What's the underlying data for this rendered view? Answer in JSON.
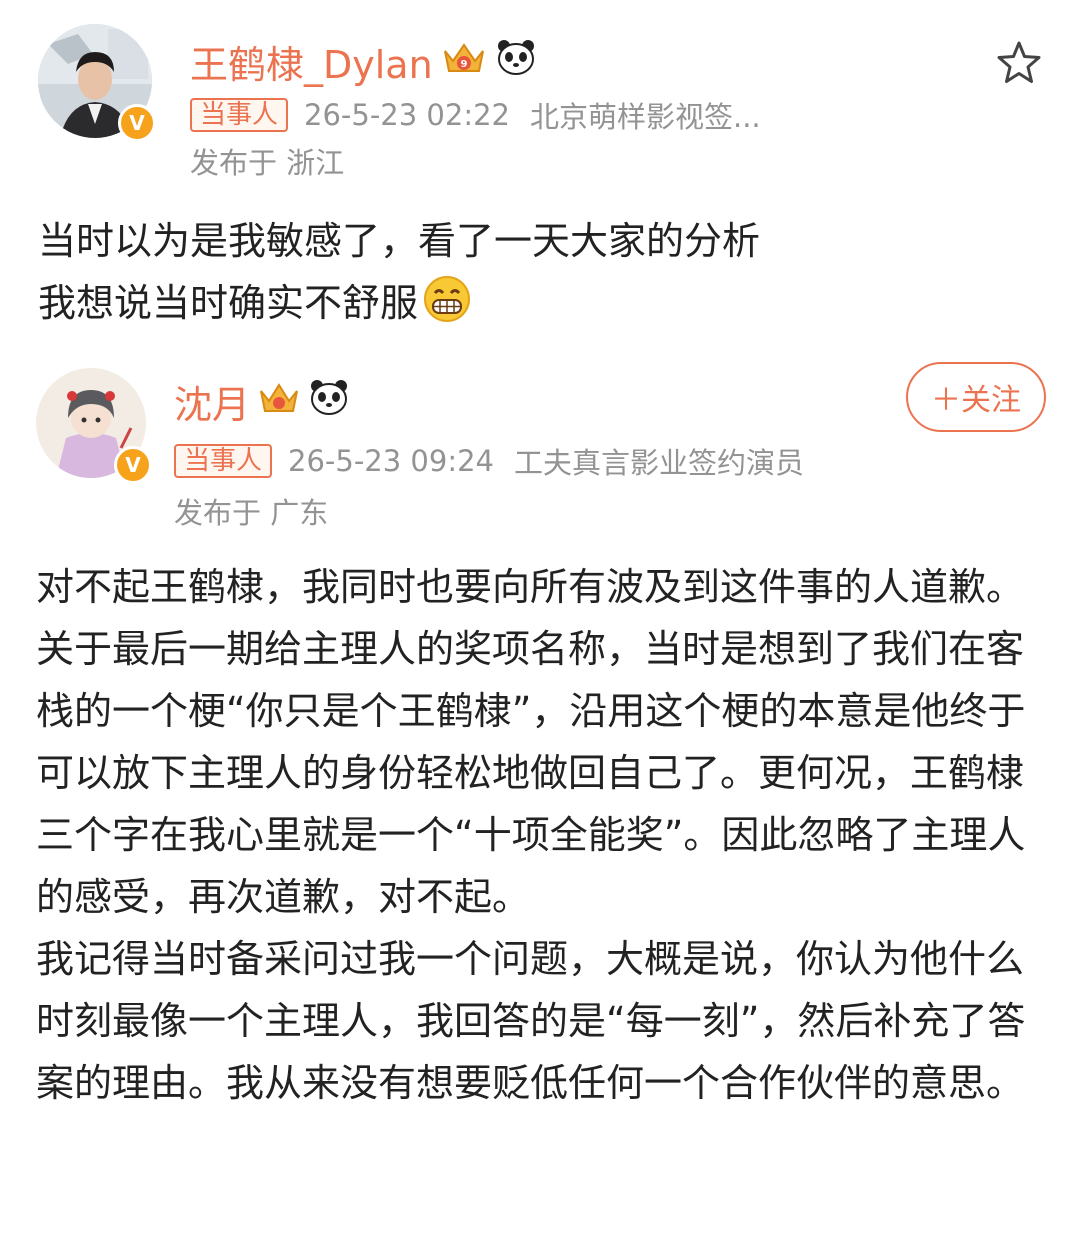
{
  "posts": [
    {
      "author": "王鹤棣_Dylan",
      "tag": "当事人",
      "time": "26-5-23 02:22",
      "source": "北京萌样影视签...",
      "location": "发布于 浙江",
      "content_lines": [
        "当时以为是我敏感了，看了一天大家的分析",
        "我想说当时确实不舒服"
      ],
      "verified_icon": "verified-v-icon",
      "badges": [
        "crown-vip-icon",
        "panda-icon"
      ],
      "action_icon": "star-icon"
    },
    {
      "author": "沈月",
      "tag": "当事人",
      "time": "26-5-23 09:24",
      "source": "工夫真言影业签约演员",
      "location": "发布于 广东",
      "follow_label": "＋关注",
      "verified_icon": "verified-v-icon",
      "badges": [
        "crown-vip-icon",
        "panda-icon"
      ],
      "content_paragraphs": [
        "对不起王鹤棣，我同时也要向所有波及到这件事的人道歉。",
        "关于最后一期给主理人的奖项名称，当时是想到了我们在客栈的一个梗“你只是个王鹤棣”，沿用这个梗的本意是他终于可以放下主理人的身份轻松地做回自己了。更何况，王鹤棣三个字在我心里就是一个“十项全能奖”。因此忽略了主理人的感受，再次道歉，对不起。",
        "我记得当时备采问过我一个问题，大概是说，你认为他什么时刻最像一个主理人，我回答的是“每一刻”，然后补充了答案的理由。我从来没有想要贬低任何一个合作伙伴的意思。"
      ]
    }
  ],
  "colors": {
    "accent": "#eb7350",
    "meta": "#939393",
    "verified": "#f7a21b",
    "text": "#222222"
  }
}
